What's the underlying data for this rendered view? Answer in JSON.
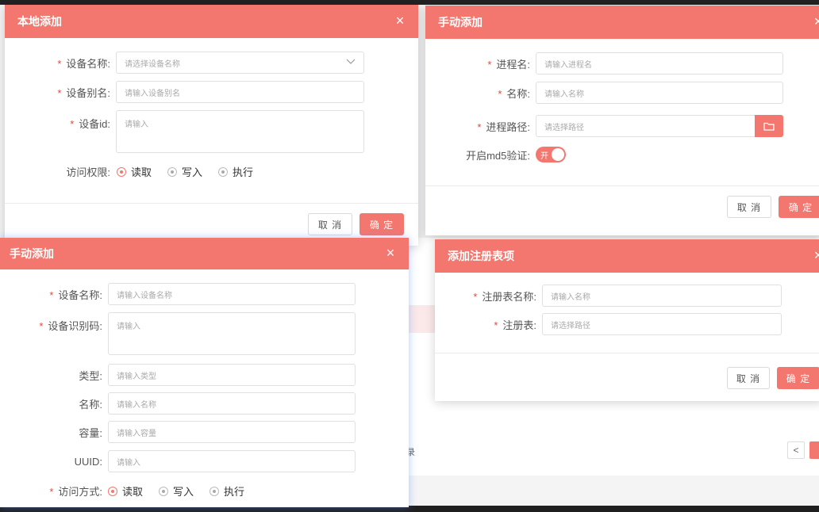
{
  "colors": {
    "accent": "#f4776f",
    "required": "#e8453c"
  },
  "bg": {
    "footer_text": "录",
    "pager_prev": "<"
  },
  "dlg1": {
    "title": "本地添加",
    "close": "×",
    "fields": {
      "name_label": "设备名称:",
      "name_placeholder": "请选择设备名称",
      "alias_label": "设备别名:",
      "alias_placeholder": "请输入设备别名",
      "id_label": "设备id:",
      "id_placeholder": "请输入",
      "perm_label": "访问权限:"
    },
    "radios": [
      "读取",
      "写入",
      "执行"
    ],
    "cancel": "取 消",
    "ok": "确 定"
  },
  "dlg2": {
    "title": "手动添加",
    "close": "×",
    "fields": {
      "proc_label": "进程名:",
      "proc_placeholder": "请输入进程名",
      "name_label": "名称:",
      "name_placeholder": "请输入名称",
      "path_label": "进程路径:",
      "path_placeholder": "请选择路径",
      "md5_label": "开启md5验证:",
      "md5_toggle": "开"
    },
    "cancel": "取 消",
    "ok": "确 定"
  },
  "dlg3": {
    "title": "手动添加",
    "close": "×",
    "fields": {
      "name_label": "设备名称:",
      "name_placeholder": "请输入设备名称",
      "code_label": "设备识别码:",
      "code_placeholder": "请输入",
      "type_label": "类型:",
      "type_placeholder": "请输入类型",
      "cname_label": "名称:",
      "cname_placeholder": "请输入名称",
      "cap_label": "容量:",
      "cap_placeholder": "请输入容量",
      "uuid_label": "UUID:",
      "uuid_placeholder": "请输入",
      "mode_label": "访问方式:"
    },
    "radios": [
      "读取",
      "写入",
      "执行"
    ]
  },
  "dlg4": {
    "title": "添加注册表项",
    "close": "×",
    "fields": {
      "reg_name_label": "注册表名称:",
      "reg_name_placeholder": "请输入名称",
      "reg_label": "注册表:",
      "reg_placeholder": "请选择路径"
    },
    "cancel": "取 消",
    "ok": "确 定"
  }
}
